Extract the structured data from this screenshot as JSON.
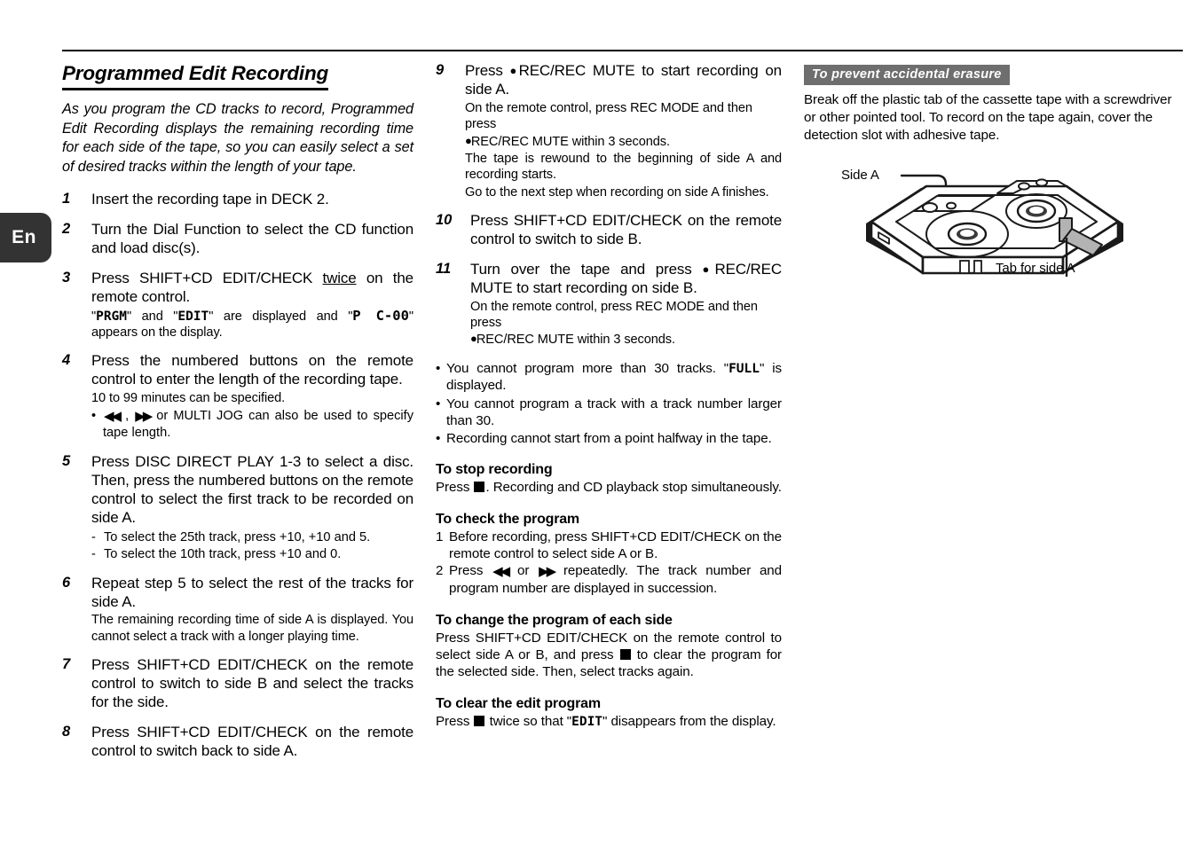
{
  "language_tab": {
    "label": "En"
  },
  "column1": {
    "title": "Programmed Edit Recording",
    "intro": "As you program the CD tracks to record, Programmed Edit Recording displays the remaining recording time for each side of the tape, so you can easily select a set of desired tracks within the length of your tape.",
    "steps": [
      {
        "num": "1",
        "lead": "Insert the recording tape in DECK 2."
      },
      {
        "num": "2",
        "lead": "Turn the Dial Function to select the CD function and load disc(s)."
      },
      {
        "num": "3",
        "lead_pre": "Press SHIFT+CD EDIT/CHECK ",
        "lead_underlined": "twice",
        "lead_post": " on the remote control.",
        "sub_pre": "\"",
        "sub_lcd1": "PRGM",
        "sub_mid1": "\" and \"",
        "sub_lcd2": "EDIT",
        "sub_mid2": "\" are displayed and \"",
        "sub_lcd3": "P  C-00",
        "sub_post": "\" appears on the display."
      },
      {
        "num": "4",
        "lead": "Press the numbered buttons on the remote control to enter the length of the recording tape.",
        "sub": "10 to 99 minutes can be specified.",
        "bullet_pre": "",
        "bullet_post": " or MULTI JOG can also be used to specify tape length."
      },
      {
        "num": "5",
        "lead": "Press DISC DIRECT PLAY 1-3 to select a disc. Then, press the numbered buttons on the remote control to select the first track to be recorded on side A.",
        "dashes": [
          "To select the 25th track, press +10, +10 and 5.",
          "To select the 10th track, press +10 and 0."
        ]
      },
      {
        "num": "6",
        "lead": "Repeat step 5 to select the rest of the tracks for side A.",
        "sub": "The remaining recording time of side A is displayed. You cannot select a track with a longer playing time."
      },
      {
        "num": "7",
        "lead": "Press SHIFT+CD EDIT/CHECK on the remote control to switch to side B and select the tracks for the side."
      },
      {
        "num": "8",
        "lead": "Press SHIFT+CD EDIT/CHECK on the remote control to switch back to side A."
      }
    ]
  },
  "column2": {
    "steps": [
      {
        "num": "9",
        "lead_pre": "Press ",
        "lead_post": "REC/REC MUTE to start recording on side A.",
        "sub1": "On the remote control, press REC MODE and then press",
        "sub2_post": "REC/REC MUTE within 3 seconds.",
        "sub3": "The tape is rewound to the beginning of side A and recording starts.",
        "sub4": "Go to the next step when recording on side A finishes."
      },
      {
        "num": "10",
        "lead": "Press SHIFT+CD EDIT/CHECK on the remote control to switch to side B."
      },
      {
        "num": "11",
        "lead_pre": "Turn over the tape and press ",
        "lead_post": "REC/REC MUTE to start recording on side B.",
        "sub1": "On the remote control, press REC MODE and then press",
        "sub2_post": "REC/REC MUTE within 3 seconds."
      }
    ],
    "notes": [
      {
        "pre": "You cannot program more than 30 tracks. \"",
        "lcd": "FULL",
        "post": "\" is displayed."
      },
      {
        "pre": "You cannot program a track with a track number larger than 30.",
        "lcd": "",
        "post": ""
      },
      {
        "pre": "Recording cannot start from a point halfway in the tape.",
        "lcd": "",
        "post": ""
      }
    ],
    "subsections": [
      {
        "heading": "To stop recording",
        "pre": "Press ",
        "post": ". Recording and CD playback stop simultaneously."
      },
      {
        "heading": "To check the program",
        "item1_num": "1",
        "item1": "Before recording, press SHIFT+CD EDIT/CHECK on the remote control to select side A or B.",
        "item2_num": "2",
        "item2_pre": "Press ",
        "item2_mid": " or ",
        "item2_post": " repeatedly. The track number and program number are displayed in succession."
      },
      {
        "heading": "To change the program of each side",
        "pre": "Press SHIFT+CD EDIT/CHECK on the remote control to select side A or B, and press ",
        "post": " to clear the program for the selected side. Then, select tracks again."
      },
      {
        "heading": "To clear the edit program",
        "pre": "Press ",
        "mid": " twice so that \"",
        "lcd": "EDIT",
        "post": "\" disappears from the display."
      }
    ]
  },
  "column3": {
    "bar_heading": "To prevent accidental erasure",
    "body": "Break off the plastic tab of the cassette tape with a screwdriver or other pointed tool. To record on the tape again, cover the detection slot with adhesive tape.",
    "figure": {
      "label_side_a": "Side A",
      "label_tab": "Tab for side A"
    }
  },
  "colors": {
    "tab_background": "#333333",
    "gray_bar": "#6e6e6e",
    "text": "#000000",
    "figure_gray": "#b3b3b3"
  }
}
